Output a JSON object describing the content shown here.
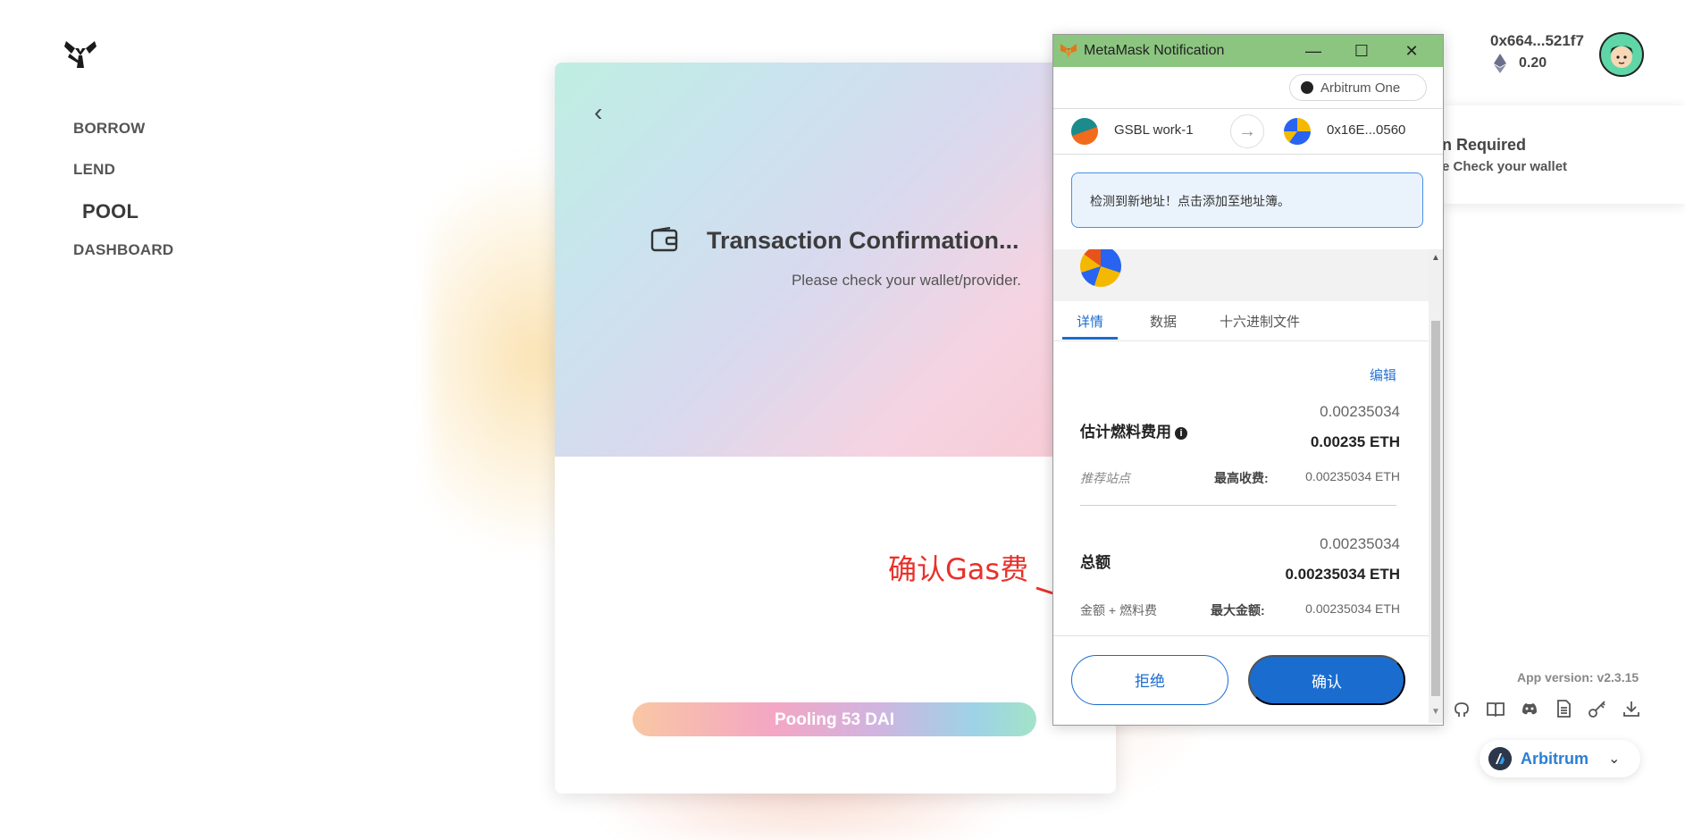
{
  "nav": {
    "items": [
      "BORROW",
      "LEND",
      "POOL",
      "DASHBOARD"
    ]
  },
  "card": {
    "back_icon": "chevron-left-icon",
    "title": "Transaction Confirmation...",
    "subtitle": "Please check your wallet/provider.",
    "pool_button": "Pooling 53 DAI"
  },
  "annotation": {
    "text": "确认Gas费",
    "color": "#e8312a"
  },
  "header": {
    "address": "0x664...521f7",
    "balance": "0.20"
  },
  "notification": {
    "title": "n Required",
    "text": "e Check your wallet"
  },
  "footer": {
    "app_version": "App version: v2.3.15",
    "network": "Arbitrum"
  },
  "metamask": {
    "window_title": "MetaMask Notification",
    "network": "Arbitrum One",
    "from_account": "GSBL work-1",
    "to_account": "0x16E...0560",
    "alert": "检测到新地址！点击添加至地址簿。",
    "tabs": [
      "详情",
      "数据",
      "十六进制文件"
    ],
    "edit": "编辑",
    "gas": {
      "label": "估计燃料费用",
      "value_plain": "0.00235034",
      "value_bold": "0.00235 ETH",
      "hint": "推荐站点",
      "max_label": "最高收费:",
      "max_value": "0.00235034 ETH"
    },
    "total": {
      "label": "总额",
      "value_plain": "0.00235034",
      "value_bold": "0.00235034 ETH",
      "hint": "金额 + 燃料费",
      "max_label": "最大金额:",
      "max_value": "0.00235034 ETH"
    },
    "reject": "拒绝",
    "confirm": "确认",
    "accent": "#1a6ccf",
    "titlebar_color": "#8bc57f"
  }
}
